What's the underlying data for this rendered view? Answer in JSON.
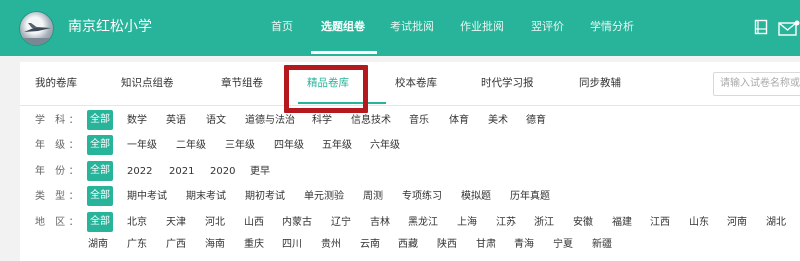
{
  "header": {
    "school_name": "南京红松小学",
    "nav": [
      "首页",
      "选题组卷",
      "考试批阅",
      "作业批阅",
      "翌评价",
      "学情分析"
    ],
    "active_nav": "选题组卷",
    "icons": [
      "notebook-icon",
      "mail-icon"
    ],
    "background": "#28b49a"
  },
  "tabs": [
    "我的卷库",
    "知识点组卷",
    "章节组卷",
    "精品卷库",
    "校本卷库",
    "时代学习报",
    "同步教辅"
  ],
  "active_tab": "精品卷库",
  "search": {
    "placeholder": "请输入试卷名称或"
  },
  "filters": {
    "subject": {
      "label": "学 科：",
      "items": [
        "全部",
        "数学",
        "英语",
        "语文",
        "道德与法治",
        "科学",
        "信息技术",
        "音乐",
        "体育",
        "美术",
        "德育"
      ]
    },
    "grade": {
      "label": "年 级：",
      "items": [
        "全部",
        "一年级",
        "二年级",
        "三年级",
        "四年级",
        "五年级",
        "六年级"
      ]
    },
    "year": {
      "label": "年 份：",
      "items": [
        "全部",
        "2022",
        "2021",
        "2020",
        "更早"
      ]
    },
    "type": {
      "label": "类 型：",
      "items": [
        "全部",
        "期中考试",
        "期末考试",
        "期初考试",
        "单元测验",
        "周测",
        "专项练习",
        "模拟题",
        "历年真题"
      ]
    },
    "region": {
      "label": "地 区：",
      "items": [
        "全部",
        "北京",
        "天津",
        "河北",
        "山西",
        "内蒙古",
        "辽宁",
        "吉林",
        "黑龙江",
        "上海",
        "江苏",
        "浙江",
        "安徽",
        "福建",
        "江西",
        "山东",
        "河南",
        "湖北"
      ]
    },
    "region_more": {
      "items": [
        "湖南",
        "广东",
        "广西",
        "海南",
        "重庆",
        "四川",
        "贵州",
        "云南",
        "西藏",
        "陕西",
        "甘肃",
        "青海",
        "宁夏",
        "新疆"
      ]
    }
  },
  "colors": {
    "accent": "#28b49a",
    "highlight": "#b3191d"
  }
}
